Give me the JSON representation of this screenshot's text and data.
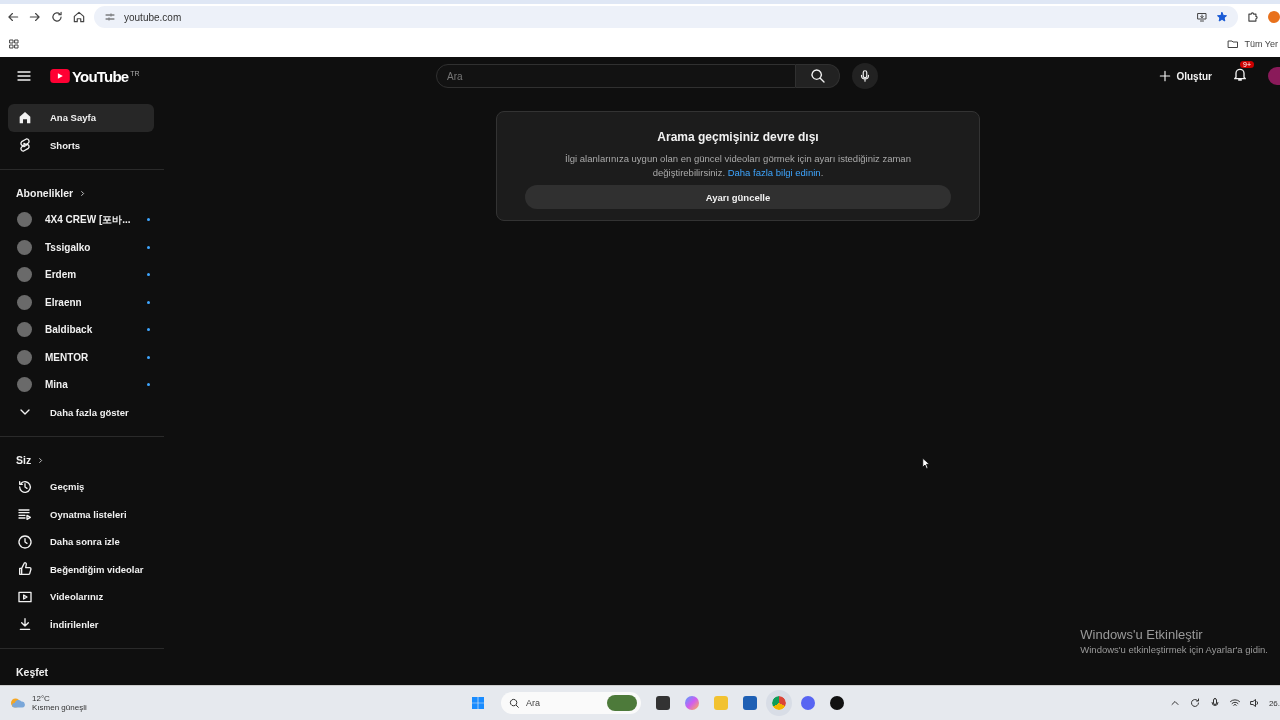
{
  "browser": {
    "address": "youtube.com",
    "bookmarks_folder": "Tüm Yer"
  },
  "header": {
    "logo": "YouTube",
    "region": "TR",
    "search_placeholder": "Ara",
    "create_label": "Oluştur",
    "notification_badge": "9+"
  },
  "nav": [
    {
      "label": "Ana Sayfa",
      "selected": true
    },
    {
      "label": "Shorts",
      "selected": false
    }
  ],
  "subscriptions": {
    "title": "Abonelikler",
    "channels": [
      {
        "name": "4X4 CREW [포바...",
        "new": true
      },
      {
        "name": "Tssigalko",
        "new": true
      },
      {
        "name": "Erdem",
        "new": true
      },
      {
        "name": "Elraenn",
        "new": true
      },
      {
        "name": "Baldiback",
        "new": true
      },
      {
        "name": "MENTOR",
        "new": true
      },
      {
        "name": "Mina",
        "new": true
      }
    ],
    "more": "Daha fazla göster"
  },
  "you": {
    "title": "Siz",
    "items": [
      {
        "label": "Geçmiş",
        "selected": false
      },
      {
        "label": "Oynatma listeleri",
        "selected": false
      },
      {
        "label": "Daha sonra izle",
        "selected": false
      },
      {
        "label": "Beğendiğim videolar",
        "selected": false
      },
      {
        "label": "Videolarınız",
        "selected": false
      },
      {
        "label": "İndirilenler",
        "selected": false
      }
    ]
  },
  "explore": {
    "title": "Keşfet"
  },
  "notice": {
    "title": "Arama geçmişiniz devre dışı",
    "text": "İlgi alanlarınıza uygun olan en güncel videoları görmek için ayarı istediğiniz zaman değiştirebilirsiniz.",
    "link": "Daha fazla bilgi edinin",
    "text_end": ".",
    "button": "Ayarı güncelle"
  },
  "activation": {
    "title": "Windows'u Etkinleştir",
    "text": "Windows'u etkinleştirmek için Ayarlar'a gidin."
  },
  "taskbar": {
    "temperature": "12°C",
    "weather": "Kısmen güneşli",
    "search_placeholder": "Ara",
    "clock": "26."
  }
}
